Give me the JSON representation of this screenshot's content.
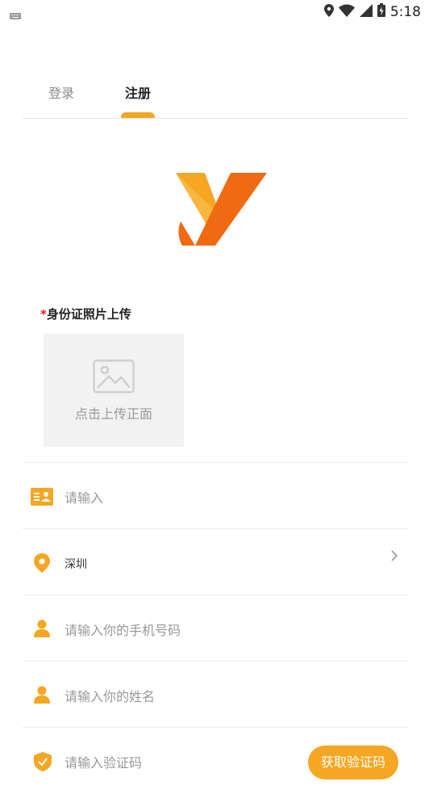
{
  "status_bar": {
    "time": "5:18"
  },
  "tabs": {
    "login": "登录",
    "register": "注册"
  },
  "upload": {
    "required_mark": "*",
    "title": "身份证照片上传",
    "button_text": "点击上传正面"
  },
  "form": {
    "id_placeholder": "请输入",
    "city_value": "深圳",
    "phone_placeholder": "请输入你的手机号码",
    "name_placeholder": "请输入你的姓名",
    "code_placeholder": "请输入验证码",
    "get_code_label": "获取验证码"
  },
  "colors": {
    "accent": "#f5a623",
    "logo_dark": "#f06a12",
    "required": "#e02020"
  },
  "icons": [
    "keyboard-icon",
    "location-icon",
    "wifi-icon",
    "signal-icon",
    "battery-icon",
    "image-icon",
    "id-card-icon",
    "map-pin-icon",
    "person-icon",
    "shield-check-icon",
    "chevron-right-icon"
  ]
}
